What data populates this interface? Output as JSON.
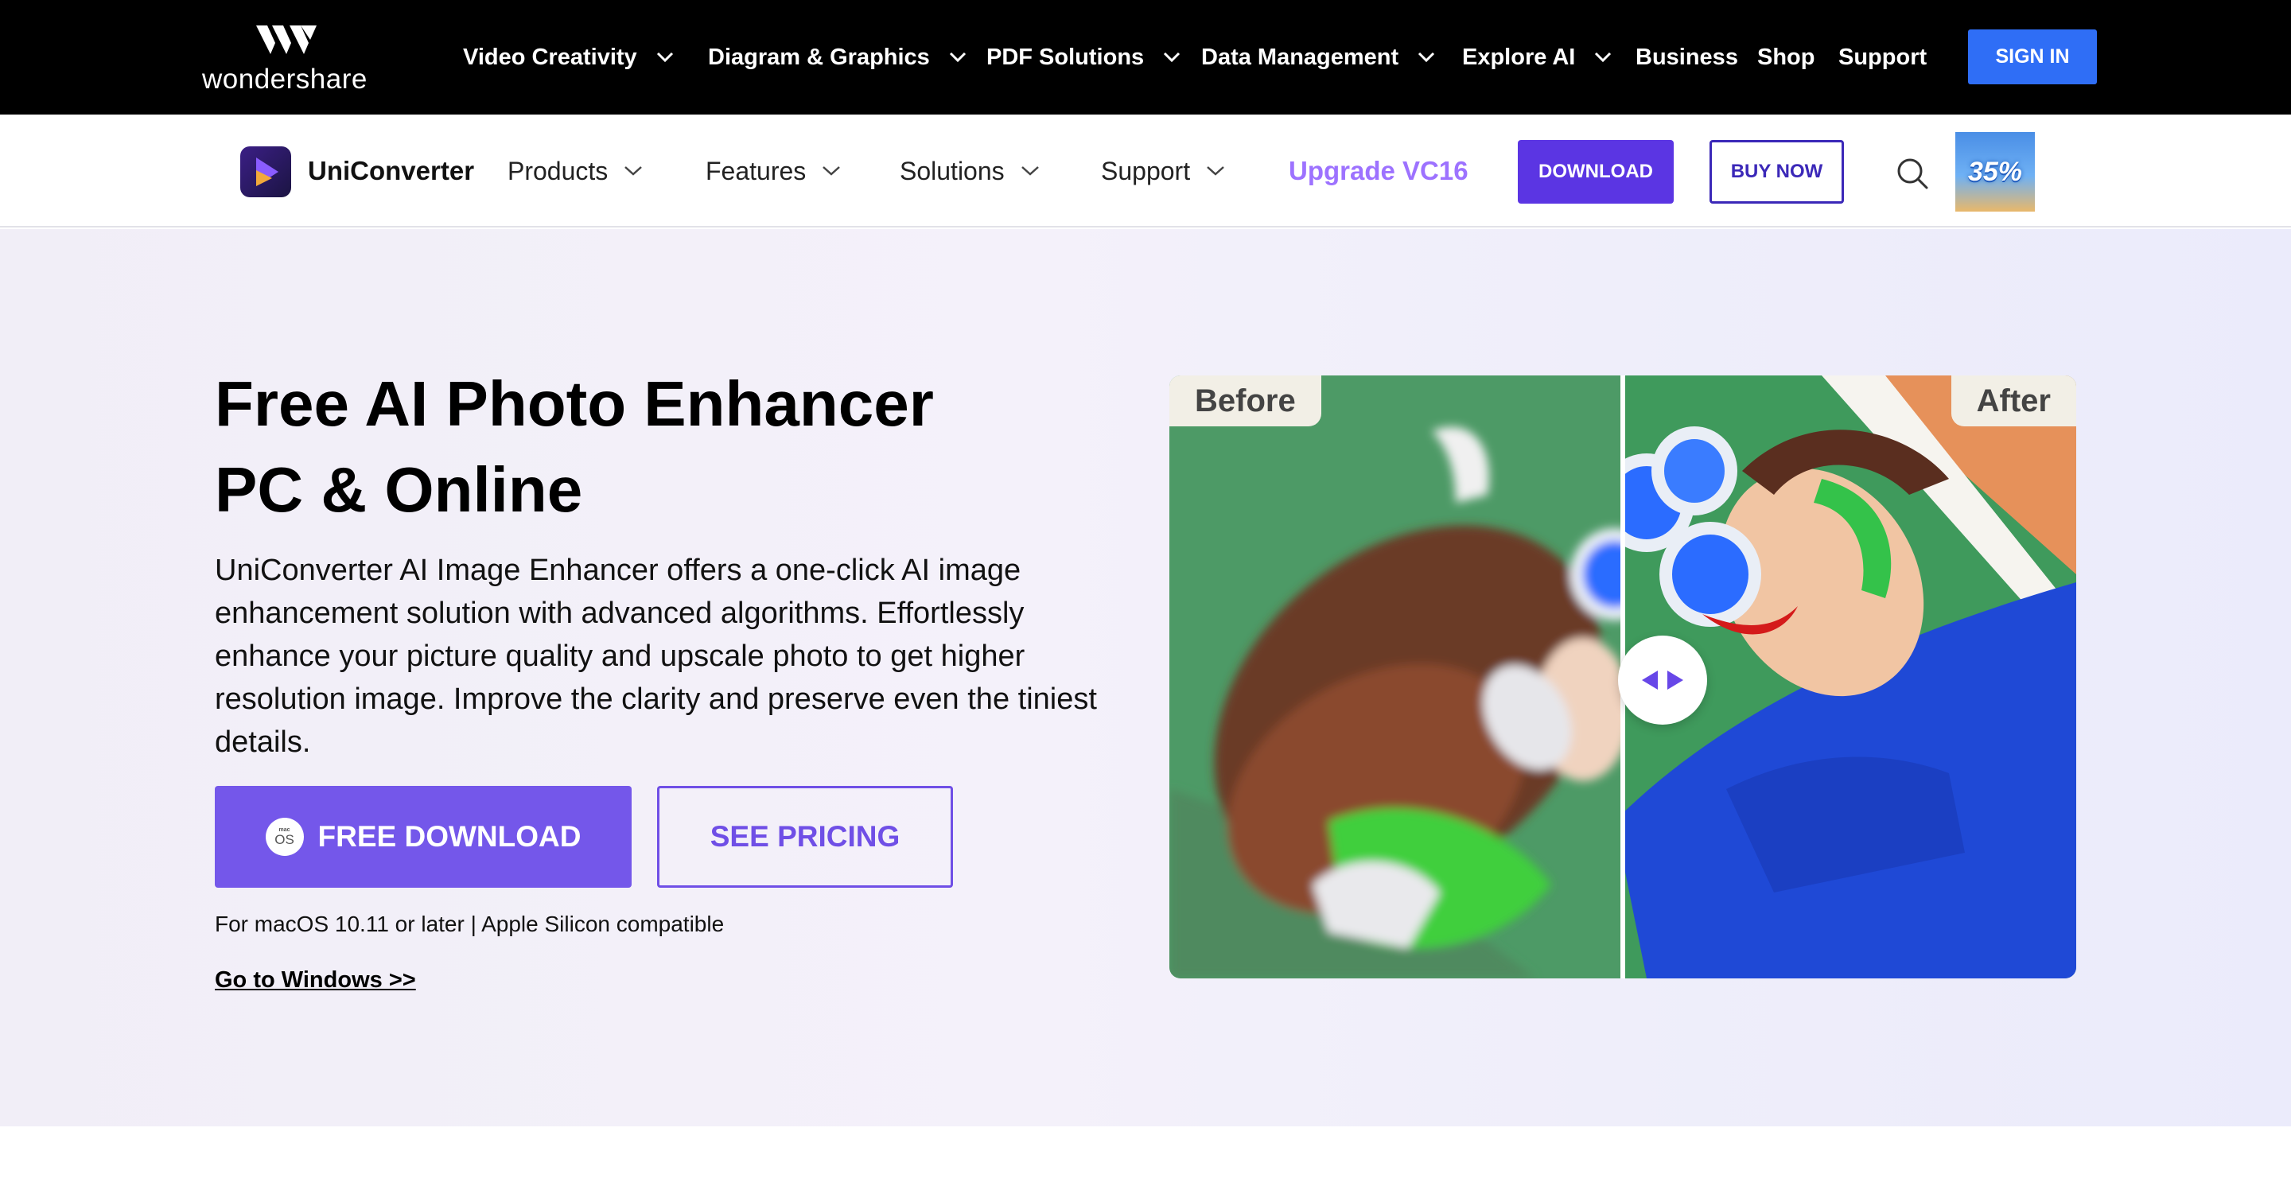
{
  "global_nav": {
    "brand": "wondershare",
    "items": [
      {
        "label": "Video Creativity",
        "has_dropdown": true
      },
      {
        "label": "Diagram & Graphics",
        "has_dropdown": true
      },
      {
        "label": "PDF Solutions",
        "has_dropdown": true
      },
      {
        "label": "Data Management",
        "has_dropdown": true
      },
      {
        "label": "Explore AI",
        "has_dropdown": true
      },
      {
        "label": "Business",
        "has_dropdown": false
      },
      {
        "label": "Shop",
        "has_dropdown": false
      },
      {
        "label": "Support",
        "has_dropdown": false
      }
    ],
    "sign_in": "SIGN IN"
  },
  "product_nav": {
    "product_name": "UniConverter",
    "items": [
      {
        "label": "Products"
      },
      {
        "label": "Features"
      },
      {
        "label": "Solutions"
      },
      {
        "label": "Support"
      }
    ],
    "upgrade": "Upgrade VC16",
    "download": "DOWNLOAD",
    "buy_now": "BUY NOW",
    "promo_badge": "35%",
    "icons": {
      "search": "search-icon"
    }
  },
  "hero": {
    "title_line1": "Free AI Photo Enhancer",
    "title_line2": "PC & Online",
    "description": "UniConverter AI Image Enhancer offers a one-click AI image enhancement solution with advanced algorithms. Effortlessly enhance your picture quality and upscale photo to get higher resolution image. Improve the clarity and preserve even the tiniest details.",
    "free_download": "FREE DOWNLOAD",
    "os_badge_small": "mac",
    "os_badge": "OS",
    "see_pricing": "SEE PRICING",
    "compat_note": "For macOS 10.11 or later | Apple Silicon compatible",
    "windows_link": "Go to Windows >>",
    "compare": {
      "before": "Before",
      "after": "After"
    }
  },
  "colors": {
    "top_bar": "#000000",
    "sign_in": "#2f6ef6",
    "primary_purple": "#5b35e3",
    "hero_button": "#7457ea",
    "upgrade_text": "#9d72ff"
  }
}
